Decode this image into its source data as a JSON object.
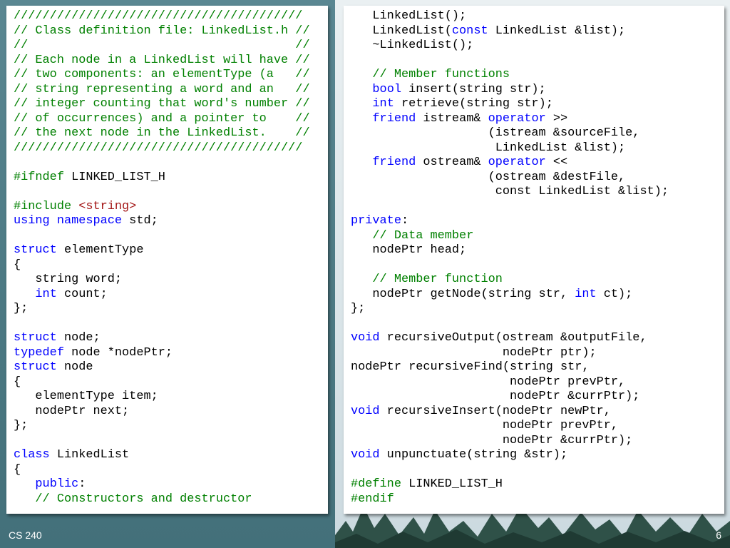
{
  "footer": {
    "course": "CS 240",
    "page_number": "6"
  },
  "code_left": [
    [
      [
        "c",
        "////////////////////////////////////////"
      ]
    ],
    [
      [
        "c",
        "// Class definition file: LinkedList.h //"
      ]
    ],
    [
      [
        "c",
        "//                                     //"
      ]
    ],
    [
      [
        "c",
        "// Each node in a LinkedList will have //"
      ]
    ],
    [
      [
        "c",
        "// two components: an elementType (a   //"
      ]
    ],
    [
      [
        "c",
        "// string representing a word and an   //"
      ]
    ],
    [
      [
        "c",
        "// integer counting that word's number //"
      ]
    ],
    [
      [
        "c",
        "// of occurrences) and a pointer to    //"
      ]
    ],
    [
      [
        "c",
        "// the next node in the LinkedList.    //"
      ]
    ],
    [
      [
        "c",
        "////////////////////////////////////////"
      ]
    ],
    [],
    [
      [
        "c",
        "#ifndef"
      ],
      [
        "p",
        " LINKED_LIST_H"
      ]
    ],
    [],
    [
      [
        "c",
        "#include "
      ],
      [
        "s",
        "<string>"
      ]
    ],
    [
      [
        "k",
        "using namespace"
      ],
      [
        "p",
        " std;"
      ]
    ],
    [],
    [
      [
        "k",
        "struct"
      ],
      [
        "p",
        " elementType"
      ]
    ],
    [
      [
        "p",
        "{"
      ]
    ],
    [
      [
        "p",
        "   string word;"
      ]
    ],
    [
      [
        "p",
        "   "
      ],
      [
        "k",
        "int"
      ],
      [
        "p",
        " count;"
      ]
    ],
    [
      [
        "p",
        "};"
      ]
    ],
    [],
    [
      [
        "k",
        "struct"
      ],
      [
        "p",
        " node;"
      ]
    ],
    [
      [
        "k",
        "typedef"
      ],
      [
        "p",
        " node *nodePtr;"
      ]
    ],
    [
      [
        "k",
        "struct"
      ],
      [
        "p",
        " node"
      ]
    ],
    [
      [
        "p",
        "{"
      ]
    ],
    [
      [
        "p",
        "   elementType item;"
      ]
    ],
    [
      [
        "p",
        "   nodePtr next;"
      ]
    ],
    [
      [
        "p",
        "};"
      ]
    ],
    [],
    [
      [
        "k",
        "class"
      ],
      [
        "p",
        " LinkedList"
      ]
    ],
    [
      [
        "p",
        "{"
      ]
    ],
    [
      [
        "p",
        "   "
      ],
      [
        "k",
        "public"
      ],
      [
        "p",
        ":"
      ]
    ],
    [
      [
        "p",
        "   "
      ],
      [
        "c",
        "// Constructors and destructor"
      ]
    ]
  ],
  "code_right": [
    [
      [
        "p",
        "   LinkedList();"
      ]
    ],
    [
      [
        "p",
        "   LinkedList("
      ],
      [
        "k",
        "const"
      ],
      [
        "p",
        " LinkedList &list);"
      ]
    ],
    [
      [
        "p",
        "   ~LinkedList();"
      ]
    ],
    [],
    [
      [
        "p",
        "   "
      ],
      [
        "c",
        "// Member functions"
      ]
    ],
    [
      [
        "p",
        "   "
      ],
      [
        "k",
        "bool"
      ],
      [
        "p",
        " insert(string str);"
      ]
    ],
    [
      [
        "p",
        "   "
      ],
      [
        "k",
        "int"
      ],
      [
        "p",
        " retrieve(string str);"
      ]
    ],
    [
      [
        "p",
        "   "
      ],
      [
        "k",
        "friend"
      ],
      [
        "p",
        " istream& "
      ],
      [
        "k",
        "operator"
      ],
      [
        "p",
        " >>"
      ]
    ],
    [
      [
        "p",
        "                   (istream &sourceFile,"
      ]
    ],
    [
      [
        "p",
        "                    LinkedList &list);"
      ]
    ],
    [
      [
        "p",
        "   "
      ],
      [
        "k",
        "friend"
      ],
      [
        "p",
        " ostream& "
      ],
      [
        "k",
        "operator"
      ],
      [
        "p",
        " <<"
      ]
    ],
    [
      [
        "p",
        "                   (ostream &destFile,"
      ]
    ],
    [
      [
        "p",
        "                    const LinkedList &list);"
      ]
    ],
    [],
    [
      [
        "k",
        "private"
      ],
      [
        "p",
        ":"
      ]
    ],
    [
      [
        "p",
        "   "
      ],
      [
        "c",
        "// Data member"
      ]
    ],
    [
      [
        "p",
        "   nodePtr head;"
      ]
    ],
    [],
    [
      [
        "p",
        "   "
      ],
      [
        "c",
        "// Member function"
      ]
    ],
    [
      [
        "p",
        "   nodePtr getNode(string str, "
      ],
      [
        "k",
        "int"
      ],
      [
        "p",
        " ct);"
      ]
    ],
    [
      [
        "p",
        "};"
      ]
    ],
    [],
    [
      [
        "k",
        "void"
      ],
      [
        "p",
        " recursiveOutput(ostream &outputFile,"
      ]
    ],
    [
      [
        "p",
        "                     nodePtr ptr);"
      ]
    ],
    [
      [
        "p",
        "nodePtr recursiveFind(string str,"
      ]
    ],
    [
      [
        "p",
        "                      nodePtr prevPtr,"
      ]
    ],
    [
      [
        "p",
        "                      nodePtr &currPtr);"
      ]
    ],
    [
      [
        "k",
        "void"
      ],
      [
        "p",
        " recursiveInsert(nodePtr newPtr,"
      ]
    ],
    [
      [
        "p",
        "                     nodePtr prevPtr,"
      ]
    ],
    [
      [
        "p",
        "                     nodePtr &currPtr);"
      ]
    ],
    [
      [
        "k",
        "void"
      ],
      [
        "p",
        " unpunctuate(string &str);"
      ]
    ],
    [],
    [
      [
        "c",
        "#define"
      ],
      [
        "p",
        " LINKED_LIST_H"
      ]
    ],
    [
      [
        "c",
        "#endif"
      ]
    ]
  ]
}
